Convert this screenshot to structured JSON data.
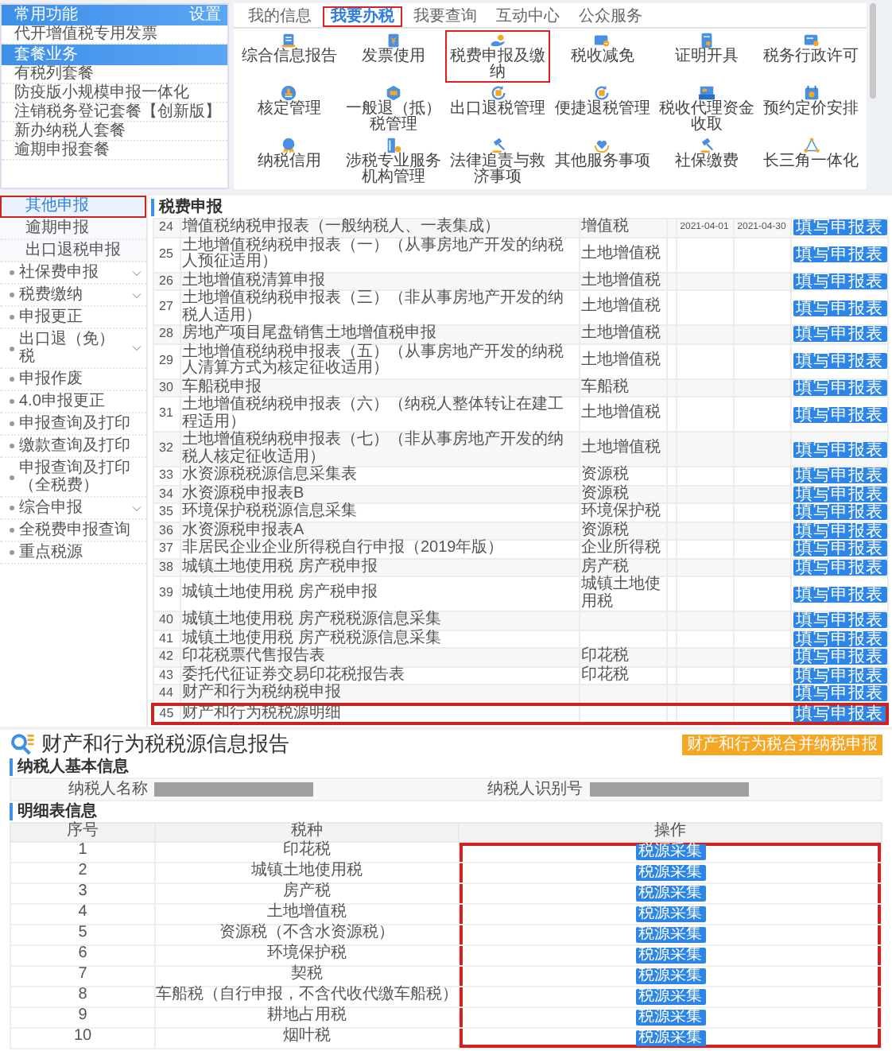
{
  "top_sidebar": [
    {
      "title": "常用功能",
      "action": "设置",
      "items": [
        "代开增值税专用发票"
      ]
    },
    {
      "title": "套餐业务",
      "items": [
        "有税列套餐",
        "防疫版小规模申报一体化",
        "注销税务登记套餐【创新版】",
        "新办纳税人套餐",
        "逾期申报套餐"
      ]
    }
  ],
  "tabs": [
    {
      "label": "我的信息",
      "selected": false,
      "highlighted": false
    },
    {
      "label": "我要办税",
      "selected": true,
      "highlighted": true
    },
    {
      "label": "我要查询",
      "selected": false,
      "highlighted": false
    },
    {
      "label": "互动中心",
      "selected": false,
      "highlighted": false
    },
    {
      "label": "公众服务",
      "selected": false,
      "highlighted": false
    }
  ],
  "services": [
    {
      "label": "综合信息报告",
      "highlighted": false
    },
    {
      "label": "发票使用",
      "highlighted": false
    },
    {
      "label": "税费申报及缴纳",
      "highlighted": true
    },
    {
      "label": "税收减免",
      "highlighted": false
    },
    {
      "label": "证明开具",
      "highlighted": false
    },
    {
      "label": "税务行政许可",
      "highlighted": false
    },
    {
      "label": "核定管理",
      "highlighted": false
    },
    {
      "label": "一般退（抵）税管理",
      "highlighted": false
    },
    {
      "label": "出口退税管理",
      "highlighted": false
    },
    {
      "label": "便捷退税管理",
      "highlighted": false
    },
    {
      "label": "税收代理资金收取",
      "highlighted": false
    },
    {
      "label": "预约定价安排",
      "highlighted": false
    },
    {
      "label": "纳税信用",
      "highlighted": false
    },
    {
      "label": "涉税专业服务机构管理",
      "highlighted": false
    },
    {
      "label": "法律追责与救济事项",
      "highlighted": false
    },
    {
      "label": "其他服务事项",
      "highlighted": false
    },
    {
      "label": "社保缴费",
      "highlighted": false
    },
    {
      "label": "长三角一体化",
      "highlighted": false
    }
  ],
  "side_menu": [
    {
      "label": "其他申报",
      "kind": "subitem",
      "selected": true,
      "highlighted": true
    },
    {
      "label": "逾期申报",
      "kind": "subitem",
      "selected": false,
      "highlighted": false
    },
    {
      "label": "出口退税申报",
      "kind": "subitem",
      "selected": false,
      "highlighted": false
    },
    {
      "label": "社保费申报",
      "kind": "group",
      "selected": false,
      "highlighted": false
    },
    {
      "label": "税费缴纳",
      "kind": "group",
      "selected": false,
      "highlighted": false
    },
    {
      "label": "申报更正",
      "kind": "link",
      "selected": false,
      "highlighted": false
    },
    {
      "label": "出口退（免）税",
      "kind": "group",
      "selected": false,
      "highlighted": false
    },
    {
      "label": "申报作废",
      "kind": "link",
      "selected": false,
      "highlighted": false
    },
    {
      "label": "4.0申报更正",
      "kind": "link",
      "selected": false,
      "highlighted": false
    },
    {
      "label": "申报查询及打印",
      "kind": "link",
      "selected": false,
      "highlighted": false
    },
    {
      "label": "缴款查询及打印",
      "kind": "link",
      "selected": false,
      "highlighted": false
    },
    {
      "label": "申报查询及打印（全税费）",
      "kind": "link",
      "selected": false,
      "highlighted": false
    },
    {
      "label": "综合申报",
      "kind": "group",
      "selected": false,
      "highlighted": false
    },
    {
      "label": "全税费申报查询",
      "kind": "link",
      "selected": false,
      "highlighted": false
    },
    {
      "label": "重点税源",
      "kind": "link",
      "selected": false,
      "highlighted": false
    }
  ],
  "declarations": {
    "heading": "税费申报",
    "rows": [
      {
        "number": "24",
        "name": "增值税纳税申报表（一般纳税人、一表集成）",
        "tax": "增值税",
        "start": "2021-04-01",
        "end": "2021-04-30",
        "action": "填写申报表",
        "highlighted": false
      },
      {
        "number": "25",
        "name": "土地增值税纳税申报表（一）（从事房地产开发的纳税人预征适用）",
        "tax": "土地增值税",
        "action": "填写申报表",
        "highlighted": false
      },
      {
        "number": "26",
        "name": "土地增值税清算申报",
        "tax": "土地增值税",
        "action": "填写申报表",
        "highlighted": false
      },
      {
        "number": "27",
        "name": "土地增值税纳税申报表（三）（非从事房地产开发的纳税人适用）",
        "tax": "土地增值税",
        "action": "填写申报表",
        "highlighted": false
      },
      {
        "number": "28",
        "name": "房地产项目尾盘销售土地增值税申报",
        "tax": "土地增值税",
        "action": "填写申报表",
        "highlighted": false
      },
      {
        "number": "29",
        "name": "土地增值税纳税申报表（五）（从事房地产开发的纳税人清算方式为核定征收适用）",
        "tax": "土地增值税",
        "action": "填写申报表",
        "highlighted": false
      },
      {
        "number": "30",
        "name": "车船税申报",
        "tax": "车船税",
        "action": "填写申报表",
        "highlighted": false
      },
      {
        "number": "31",
        "name": "土地增值税纳税申报表（六）（纳税人整体转让在建工程适用）",
        "tax": "土地增值税",
        "action": "填写申报表",
        "highlighted": false
      },
      {
        "number": "32",
        "name": "土地增值税纳税申报表（七）（非从事房地产开发的纳税人核定征收适用）",
        "tax": "土地增值税",
        "action": "填写申报表",
        "highlighted": false
      },
      {
        "number": "33",
        "name": "水资源税税源信息采集表",
        "tax": "资源税",
        "action": "填写申报表",
        "highlighted": false
      },
      {
        "number": "34",
        "name": "水资源税申报表B",
        "tax": "资源税",
        "action": "填写申报表",
        "highlighted": false
      },
      {
        "number": "35",
        "name": "环境保护税税源信息采集",
        "tax": "环境保护税",
        "action": "填写申报表",
        "highlighted": false
      },
      {
        "number": "36",
        "name": "水资源税申报表A",
        "tax": "资源税",
        "action": "填写申报表",
        "highlighted": false
      },
      {
        "number": "37",
        "name": "非居民企业企业所得税自行申报（2019年版）",
        "tax": "企业所得税",
        "action": "填写申报表",
        "highlighted": false
      },
      {
        "number": "38",
        "name": "城镇土地使用税 房产税申报",
        "tax": "房产税",
        "action": "填写申报表",
        "highlighted": false
      },
      {
        "number": "39",
        "name": "城镇土地使用税 房产税申报",
        "tax": "城镇土地使用税",
        "action": "填写申报表",
        "highlighted": false
      },
      {
        "number": "40",
        "name": "城镇土地使用税 房产税税源信息采集",
        "action": "填写申报表",
        "highlighted": false
      },
      {
        "number": "41",
        "name": "城镇土地使用税 房产税税源信息采集",
        "action": "填写申报表",
        "highlighted": false
      },
      {
        "number": "42",
        "name": "印花税票代售报告表",
        "tax": "印花税",
        "action": "填写申报表",
        "highlighted": false
      },
      {
        "number": "43",
        "name": "委托代征证券交易印花税报告表",
        "tax": "印花税",
        "action": "填写申报表",
        "highlighted": false
      },
      {
        "number": "44",
        "name": "财产和行为税纳税申报",
        "action": "填写申报表",
        "highlighted": false
      },
      {
        "number": "45",
        "name": "财产和行为税税源明细",
        "action": "填写申报表",
        "highlighted": true
      }
    ]
  },
  "report": {
    "title": "财产和行为税税源信息报告",
    "action_button": "财产和行为税合并纳税申报",
    "taxpayer": {
      "heading": "纳税人基本信息",
      "fields": [
        {
          "label": "纳税人名称",
          "redacted": true
        },
        {
          "label": "纳税人识别号",
          "redacted": true
        }
      ]
    },
    "detail": {
      "heading": "明细表信息",
      "columns": [
        "序号",
        "税种",
        "操作"
      ],
      "action_column_highlighted": true,
      "rows": [
        {
          "number": "1",
          "tax": "印花税",
          "action": "税源采集"
        },
        {
          "number": "2",
          "tax": "城镇土地使用税",
          "action": "税源采集"
        },
        {
          "number": "3",
          "tax": "房产税",
          "action": "税源采集"
        },
        {
          "number": "4",
          "tax": "土地增值税",
          "action": "税源采集"
        },
        {
          "number": "5",
          "tax": "资源税（不含水资源税）",
          "action": "税源采集"
        },
        {
          "number": "6",
          "tax": "环境保护税",
          "action": "税源采集"
        },
        {
          "number": "7",
          "tax": "契税",
          "action": "税源采集"
        },
        {
          "number": "8",
          "tax": "车船税（自行申报，不含代收代缴车船税）",
          "action": "税源采集"
        },
        {
          "number": "9",
          "tax": "耕地占用税",
          "action": "税源采集"
        },
        {
          "number": "10",
          "tax": "烟叶税",
          "action": "税源采集"
        }
      ]
    }
  }
}
